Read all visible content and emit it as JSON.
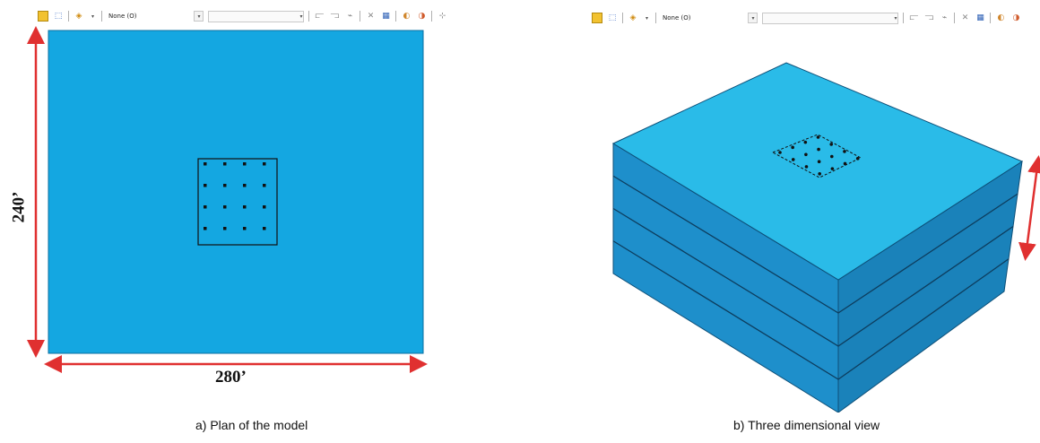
{
  "toolbar_left": {
    "selection_combo_value": "None (O)",
    "icons": [
      "select-icon",
      "sketch-icon",
      "color-code-icon",
      "dim-icon",
      "query-icon",
      "mesh-icon",
      "view-cut-icon",
      "fix-icon"
    ]
  },
  "toolbar_right": {
    "selection_combo_value": "None (O)"
  },
  "plan": {
    "caption": "a) Plan of the model",
    "width_label": "280’",
    "height_label": "240’",
    "pile_rows": 4,
    "pile_cols": 4
  },
  "view3d": {
    "caption": "b) Three dimensional view",
    "layers": 4,
    "pile_rows": 4,
    "pile_cols": 4
  },
  "colors": {
    "plan_fill": "#14a7e1",
    "top_face": "#29bce8",
    "side_front": "#1f8fc8",
    "side_right": "#1a7fb6",
    "dimension_arrow": "#e03030"
  }
}
